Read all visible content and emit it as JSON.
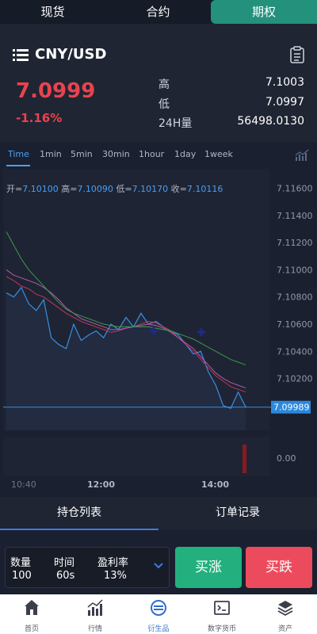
{
  "top_tabs": [
    "现货",
    "合约",
    "期权"
  ],
  "header": {
    "pair": "CNY/USD",
    "last_price": "7.0999",
    "change": "-1.16%",
    "stats": [
      {
        "label": "高",
        "value": "7.1003"
      },
      {
        "label": "低",
        "value": "7.0997"
      },
      {
        "label": "24H量",
        "value": "56498.0130"
      }
    ]
  },
  "periods": [
    "Time",
    "1min",
    "5min",
    "30min",
    "1hour",
    "1day",
    "1week"
  ],
  "ohlc": {
    "open_label": "开=",
    "open": "7.10100",
    "high_label": "高=",
    "high": "7.10090",
    "low_label": "低=",
    "low": "7.10170",
    "close_label": "收=",
    "close": "7.10116"
  },
  "chart_data": {
    "type": "line",
    "y_ticks": [
      "7.11600",
      "7.11400",
      "7.11200",
      "7.11000",
      "7.10800",
      "7.10600",
      "7.10400",
      "7.10200"
    ],
    "x_ticks": [
      "10:40",
      "12:00",
      "14:00"
    ],
    "current_price_label": "7.09989",
    "volume_tick": "0.00",
    "ylim": [
      7.099,
      7.1165
    ],
    "series": [
      {
        "values": [
          7.1083,
          7.108,
          7.1087,
          7.1075,
          7.107,
          7.1078,
          7.105,
          7.1045,
          7.1042,
          7.106,
          7.1048,
          7.1052,
          7.1055,
          7.105,
          7.106,
          7.1056,
          7.1065,
          7.1058,
          7.1068,
          7.106,
          7.1062,
          7.1058,
          7.1055,
          7.1052,
          7.1045,
          7.1038,
          7.104,
          7.1025,
          7.1015,
          7.1,
          7.0998,
          7.101,
          7.0999
        ]
      },
      {
        "values": [
          7.1095,
          7.1092,
          7.1088,
          7.1086,
          7.1082,
          7.108,
          7.1076,
          7.1072,
          7.1068,
          7.1065,
          7.1062,
          7.106,
          7.1058,
          7.1056,
          7.1054,
          7.1055,
          7.1057,
          7.1058,
          7.106,
          7.1062,
          7.1061,
          7.1058,
          7.1055,
          7.105,
          7.1045,
          7.104,
          7.1034,
          7.1028,
          7.1022,
          7.1018,
          7.1014,
          7.1012,
          7.101
        ]
      },
      {
        "values": [
          7.11,
          7.1096,
          7.1094,
          7.1092,
          7.109,
          7.1087,
          7.1083,
          7.1078,
          7.1072,
          7.1068,
          7.1064,
          7.1062,
          7.106,
          7.1058,
          7.1056,
          7.1056,
          7.1057,
          7.1058,
          7.1059,
          7.106,
          7.1059,
          7.1057,
          7.1054,
          7.105,
          7.1046,
          7.1042,
          7.1036,
          7.103,
          7.1024,
          7.102,
          7.1017,
          7.1015,
          7.1013
        ]
      },
      {
        "values": [
          7.1128,
          7.1118,
          7.1108,
          7.11,
          7.1094,
          7.1088,
          7.1082,
          7.1076,
          7.1071,
          7.1068,
          7.1066,
          7.1064,
          7.1062,
          7.106,
          7.1059,
          7.1058,
          7.1058,
          7.1058,
          7.1058,
          7.1058,
          7.1057,
          7.1056,
          7.1055,
          7.1053,
          7.1051,
          7.1049,
          7.1046,
          7.1043,
          7.104,
          7.1037,
          7.1034,
          7.1032,
          7.103
        ]
      }
    ],
    "colors": {
      "price": "#3a8fe0",
      "ma1": "#c2365e",
      "ma2": "#b35aa8",
      "ma3": "#3b9a4a"
    }
  },
  "position_tabs": [
    "持仓列表",
    "订单记录"
  ],
  "order": {
    "qty_label": "数量",
    "qty": "100",
    "time_label": "时间",
    "time": "60s",
    "profit_label": "盈利率",
    "profit": "13%",
    "buy_up": "买涨",
    "buy_down": "买跌"
  },
  "nav": [
    "首页",
    "行情",
    "衍生品",
    "数字货币",
    "资产"
  ],
  "colors": {
    "accent": "#23917c",
    "up": "#23b07e",
    "down": "#ec4b5d",
    "link": "#4a9ff5"
  }
}
